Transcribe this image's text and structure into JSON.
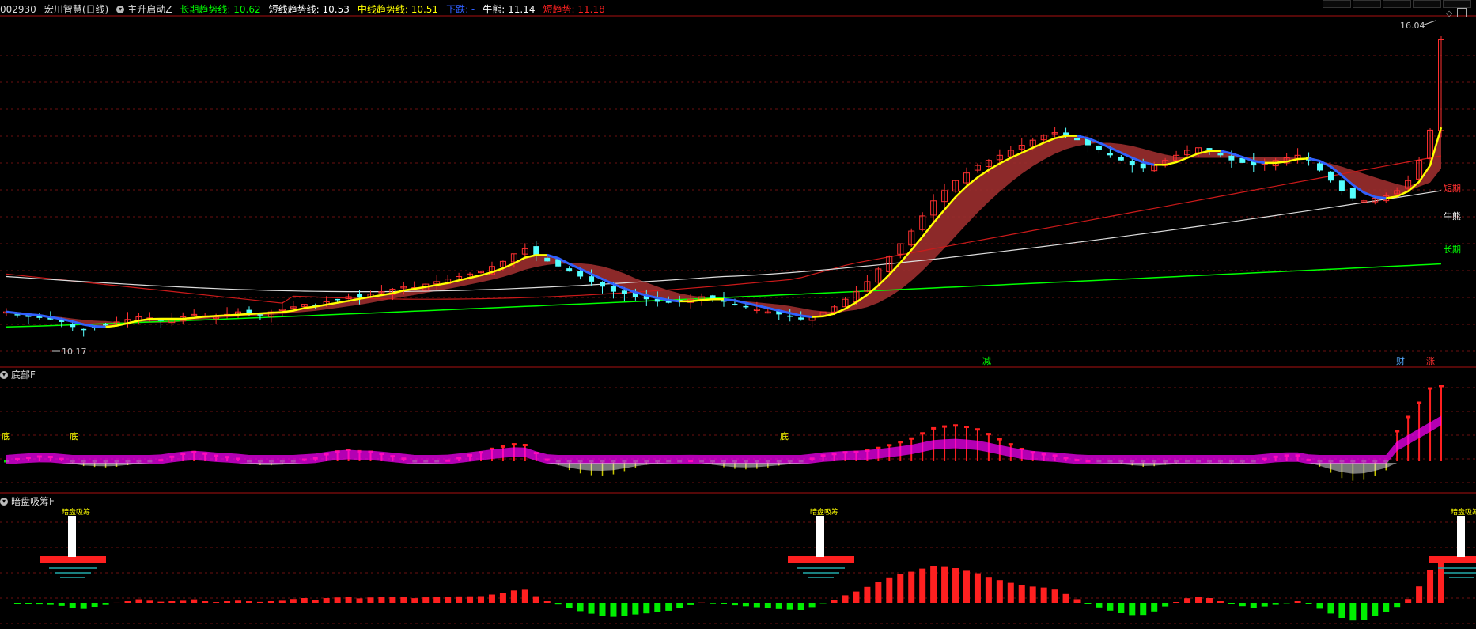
{
  "colors": {
    "green": "#00ff00",
    "white": "#ffffff",
    "yellow": "#ffff00",
    "blue": "#3060ff",
    "red": "#ff2020",
    "cyan": "#55ffff",
    "ribbon": "#9b2d2d",
    "magenta": "#ff00ff",
    "darkred": "#aa1a1a"
  },
  "header": {
    "code": "002930",
    "name": "宏川智慧(日线)",
    "indicator": "主升启动Z",
    "long": "长期趋势线: 10.62",
    "short": "短线趋势线: 10.53",
    "mid": "中线趋势线: 10.51",
    "down": "下跌: -",
    "bull": "牛熊: 11.14",
    "shortrend": "短趋势: 11.18"
  },
  "panel2": {
    "title": "底部F"
  },
  "panel3": {
    "title": "暗盘吸筹F"
  },
  "chart_data": [
    {
      "type": "candlestick",
      "ylim": [
        9.6,
        16.4
      ],
      "yticks": [],
      "grid": "dashed-horizontal",
      "annotations": {
        "high": "16.04",
        "low": "10.17",
        "long_label": "长期",
        "bull_label": "牛熊",
        "short_label": "短期",
        "mark1": "减",
        "mark2": "财",
        "mark3": "涨"
      },
      "closes": [
        10.6,
        10.55,
        10.5,
        10.48,
        10.45,
        10.4,
        10.3,
        10.25,
        10.3,
        10.35,
        10.4,
        10.45,
        10.5,
        10.48,
        10.42,
        10.45,
        10.5,
        10.55,
        10.52,
        10.5,
        10.55,
        10.6,
        10.58,
        10.55,
        10.6,
        10.65,
        10.7,
        10.75,
        10.72,
        10.8,
        10.85,
        10.9,
        10.88,
        10.95,
        11.0,
        11.05,
        11.1,
        11.08,
        11.15,
        11.2,
        11.25,
        11.3,
        11.35,
        11.4,
        11.5,
        11.6,
        11.75,
        11.85,
        11.7,
        11.6,
        11.5,
        11.4,
        11.3,
        11.2,
        11.1,
        11.0,
        10.95,
        10.9,
        10.85,
        10.8,
        10.78,
        10.8,
        10.85,
        10.9,
        10.85,
        10.8,
        10.75,
        10.7,
        10.65,
        10.6,
        10.55,
        10.5,
        10.45,
        10.5,
        10.6,
        10.7,
        10.85,
        11.0,
        11.2,
        11.45,
        11.7,
        11.95,
        12.2,
        12.5,
        12.8,
        13.0,
        13.2,
        13.35,
        13.5,
        13.6,
        13.7,
        13.8,
        13.9,
        14.0,
        14.1,
        14.15,
        14.1,
        14.0,
        13.9,
        13.8,
        13.7,
        13.6,
        13.5,
        13.45,
        13.5,
        13.6,
        13.7,
        13.8,
        13.85,
        13.8,
        13.7,
        13.6,
        13.55,
        13.5,
        13.55,
        13.6,
        13.65,
        13.7,
        13.6,
        13.4,
        13.2,
        13.0,
        12.85,
        12.8,
        12.85,
        12.9,
        13.0,
        13.2,
        13.6,
        14.2,
        16.0
      ],
      "lines": {
        "long": [
          10.28,
          10.62
        ],
        "bull": [
          10.65,
          12.55
        ],
        "short": [
          10.7,
          13.05
        ]
      }
    },
    {
      "type": "area",
      "annotations": {
        "label": "底"
      }
    },
    {
      "type": "bar",
      "annotations": {
        "label": "暗盘吸筹"
      }
    }
  ]
}
